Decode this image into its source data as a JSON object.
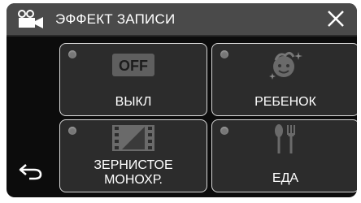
{
  "header": {
    "title": "ЭФФЕКТ ЗАПИСИ"
  },
  "options": [
    {
      "label": "ВЫКЛ",
      "icon": "off-icon"
    },
    {
      "label": "РЕБЕНОК",
      "icon": "baby-face-icon"
    },
    {
      "label_line1": "ЗЕРНИСТОЕ",
      "label_line2": "МОНОХР.",
      "icon": "grainy-film-icon"
    },
    {
      "label": "ЕДА",
      "icon": "cutlery-icon"
    }
  ],
  "icons": {
    "off_text": "OFF"
  },
  "colors": {
    "background": "#0c0c0c",
    "topbar": "#4a4a4a",
    "button": "#2c2c2c",
    "border": "#d8d8d8",
    "text": "#ffffff"
  }
}
